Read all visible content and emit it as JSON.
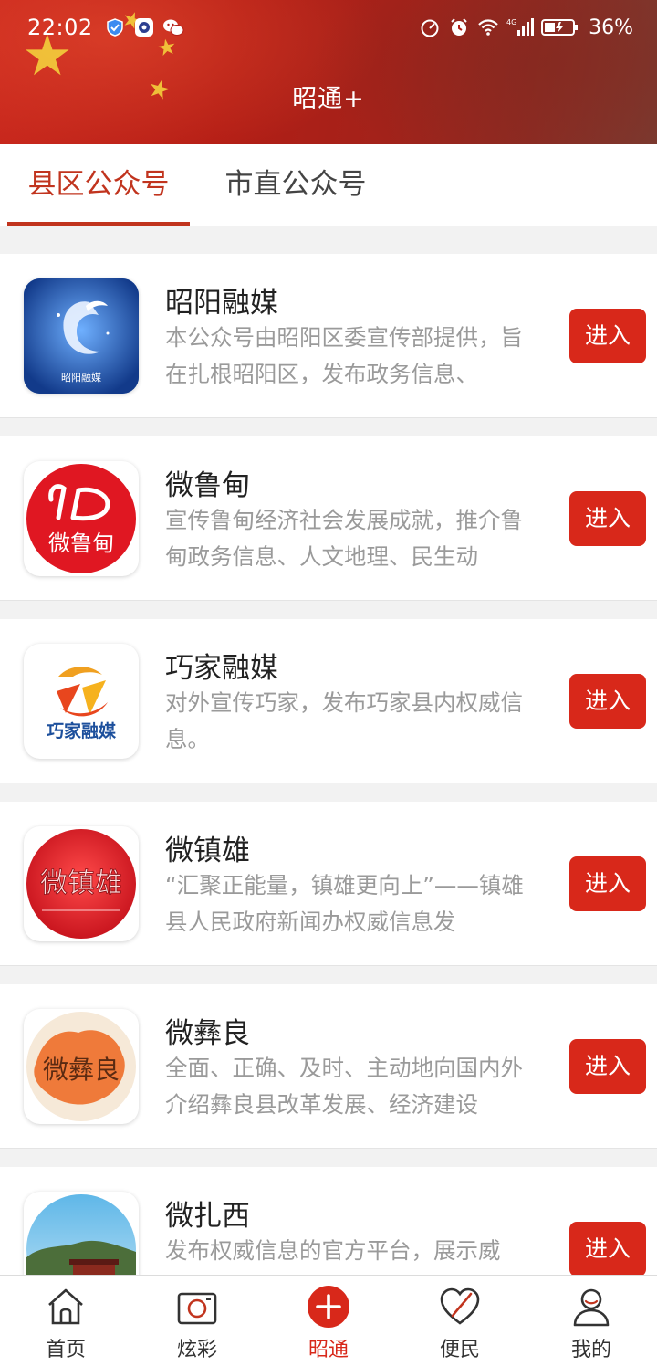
{
  "status_bar": {
    "time": "22:02",
    "battery": "36%",
    "network": "4G"
  },
  "header": {
    "title": "昭通+"
  },
  "tabs": [
    {
      "label": "县区公众号",
      "active": true
    },
    {
      "label": "市直公众号",
      "active": false
    }
  ],
  "accounts": [
    {
      "name": "昭阳融媒",
      "desc": "本公众号由昭阳区委宣传部提供，旨在扎根昭阳区，发布政务信息、",
      "button": "进入",
      "logo_text": "昭阳融媒"
    },
    {
      "name": "微鲁甸",
      "desc": "宣传鲁甸经济社会发展成就，推介鲁甸政务信息、人文地理、民生动",
      "button": "进入",
      "logo_text": "微鲁甸"
    },
    {
      "name": "巧家融媒",
      "desc": "对外宣传巧家，发布巧家县内权威信息。",
      "button": "进入",
      "logo_text": "巧家融媒"
    },
    {
      "name": "微镇雄",
      "desc": "“汇聚正能量，镇雄更向上”——镇雄县人民政府新闻办权威信息发",
      "button": "进入",
      "logo_text": "微镇雄"
    },
    {
      "name": "微彝良",
      "desc": "全面、正确、及时、主动地向国内外介绍彝良县改革发展、经济建设",
      "button": "进入",
      "logo_text": "微彝良"
    },
    {
      "name": "微扎西",
      "desc": "发布权威信息的官方平台，展示威",
      "button": "进入",
      "logo_text": ""
    }
  ],
  "bottom_nav": [
    {
      "label": "首页",
      "icon": "home-icon",
      "active": false
    },
    {
      "label": "炫彩",
      "icon": "camera-icon",
      "active": false
    },
    {
      "label": "昭通",
      "icon": "plus-circle-icon",
      "active": true
    },
    {
      "label": "便民",
      "icon": "heart-icon",
      "active": false
    },
    {
      "label": "我的",
      "icon": "user-icon",
      "active": false
    }
  ],
  "colors": {
    "accent": "#d8281a",
    "tab_active": "#c1341e"
  }
}
